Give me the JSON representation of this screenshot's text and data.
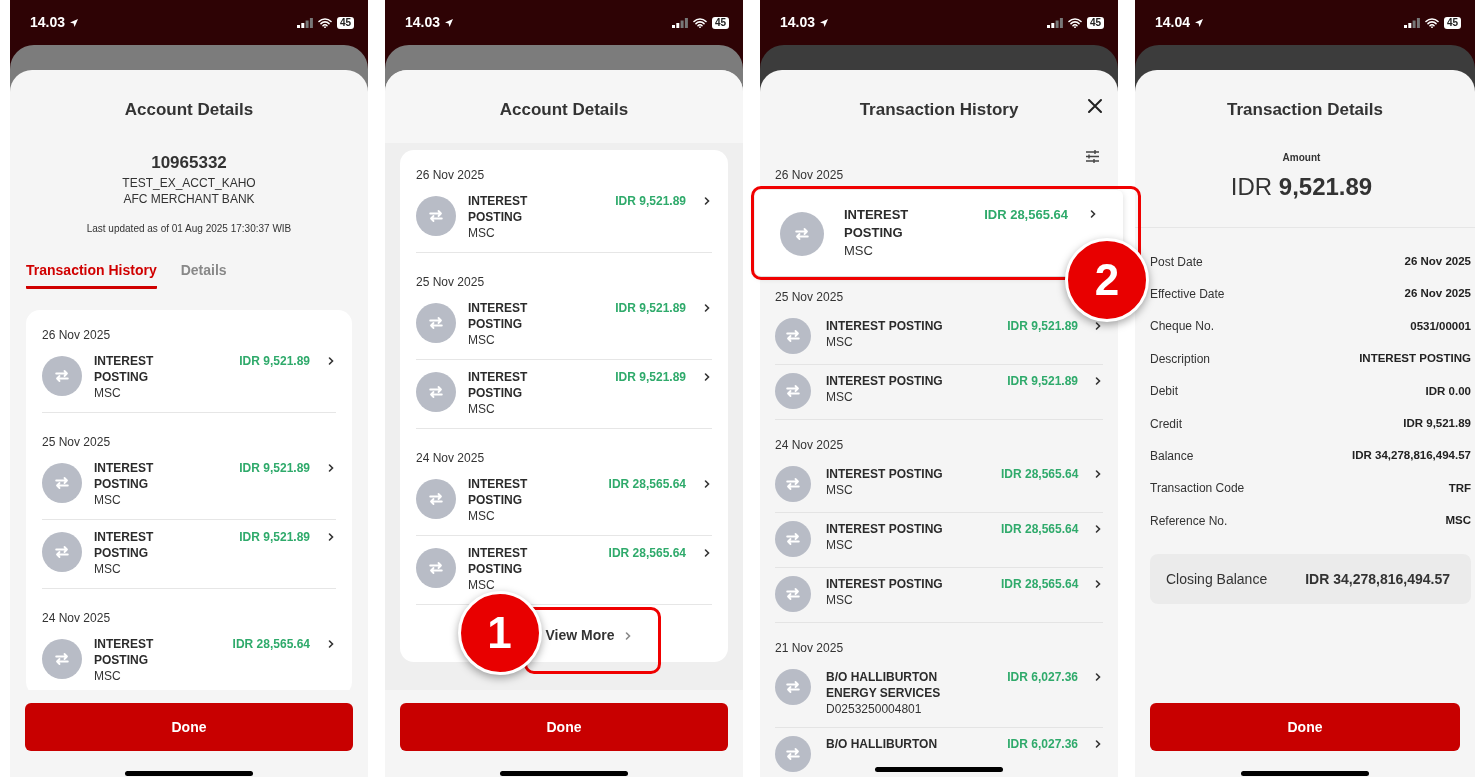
{
  "screens": [
    {
      "kind": "account",
      "status_time": "14.03",
      "battery": "45",
      "title": "Account Details",
      "account_number": "10965332",
      "account_name": "TEST_EX_ACCT_KAHO",
      "bank": "AFC MERCHANT BANK",
      "last_updated": "Last updated as of 01 Aug 2025 17:30:37 WIB",
      "tabs": [
        {
          "label": "Transaction History",
          "selected": true
        },
        {
          "label": "Details",
          "selected": false
        }
      ],
      "groups": [
        {
          "date": "26 Nov 2025",
          "items": [
            {
              "title": "INTEREST POSTING",
              "amount": "IDR 9,521.89",
              "reference": "MSC"
            }
          ]
        },
        {
          "date": "25 Nov 2025",
          "items": [
            {
              "title": "INTEREST POSTING",
              "amount": "IDR 9,521.89",
              "reference": "MSC"
            },
            {
              "title": "INTEREST POSTING",
              "amount": "IDR 9,521.89",
              "reference": "MSC"
            }
          ]
        },
        {
          "date": "24 Nov 2025",
          "items": [
            {
              "title": "INTEREST POSTING",
              "amount": "IDR 28,565.64",
              "reference": "MSC"
            }
          ]
        }
      ],
      "done": "Done"
    },
    {
      "kind": "list",
      "status_time": "14.03",
      "battery": "45",
      "title": "Account Details",
      "groups": [
        {
          "date": "26 Nov 2025",
          "items": [
            {
              "title": "INTEREST POSTING",
              "amount": "IDR 9,521.89",
              "reference": "MSC"
            }
          ]
        },
        {
          "date": "25 Nov 2025",
          "items": [
            {
              "title": "INTEREST POSTING",
              "amount": "IDR 9,521.89",
              "reference": "MSC"
            },
            {
              "title": "INTEREST POSTING",
              "amount": "IDR 9,521.89",
              "reference": "MSC"
            }
          ]
        },
        {
          "date": "24 Nov 2025",
          "items": [
            {
              "title": "INTEREST POSTING",
              "amount": "IDR 28,565.64",
              "reference": "MSC"
            },
            {
              "title": "INTEREST POSTING",
              "amount": "IDR 28,565.64",
              "reference": "MSC"
            }
          ]
        }
      ],
      "view_more": "View More",
      "annotation": "1",
      "done": "Done"
    },
    {
      "kind": "history",
      "status_time": "14.03",
      "battery": "45",
      "title": "Transaction History",
      "groups": [
        {
          "date": "26 Nov 2025",
          "items": [
            {
              "title": "INTEREST POSTING",
              "amount": "IDR 28,565.64",
              "reference": "MSC",
              "selected": true
            }
          ]
        },
        {
          "date": "25 Nov 2025",
          "items": [
            {
              "title": "INTEREST POSTING",
              "amount": "IDR 9,521.89",
              "reference": "MSC",
              "selected": false
            },
            {
              "title": "INTEREST POSTING",
              "amount": "IDR 9,521.89",
              "reference": "MSC",
              "selected": false
            }
          ]
        },
        {
          "date": "24 Nov 2025",
          "items": [
            {
              "title": "INTEREST POSTING",
              "amount": "IDR 28,565.64",
              "reference": "MSC",
              "selected": false
            },
            {
              "title": "INTEREST POSTING",
              "amount": "IDR 28,565.64",
              "reference": "MSC",
              "selected": false
            },
            {
              "title": "INTEREST POSTING",
              "amount": "IDR 28,565.64",
              "reference": "MSC",
              "selected": false
            }
          ]
        },
        {
          "date": "21 Nov 2025",
          "items": [
            {
              "title": "B/O HALLIBURTON ENERGY SERVICES",
              "amount": "IDR 6,027.36",
              "reference": "D0253250004801",
              "selected": false
            },
            {
              "title": "B/O HALLIBURTON",
              "amount": "IDR 6,027.36",
              "selected": false
            }
          ]
        }
      ],
      "annotation": "2"
    },
    {
      "kind": "details",
      "status_time": "14.04",
      "battery": "45",
      "title": "Transaction Details",
      "amount_label": "Amount",
      "amount_currency": "IDR",
      "amount_value": "9,521.89",
      "fields": [
        {
          "label": "Post Date",
          "value": "26 Nov 2025"
        },
        {
          "label": "Effective Date",
          "value": "26 Nov 2025"
        },
        {
          "label": "Cheque No.",
          "value": "0531/00001"
        },
        {
          "label": "Description",
          "value": "INTEREST POSTING"
        },
        {
          "label": "Debit",
          "value": "IDR 0.00"
        },
        {
          "label": "Credit",
          "value": "IDR 9,521.89"
        },
        {
          "label": "Balance",
          "value": "IDR 34,278,816,494.57"
        },
        {
          "label": "Transaction Code",
          "value": "TRF"
        },
        {
          "label": "Reference No.",
          "value": "MSC"
        }
      ],
      "closing_label": "Closing Balance",
      "closing_value": "IDR 34,278,816,494.57",
      "done": "Done"
    }
  ]
}
